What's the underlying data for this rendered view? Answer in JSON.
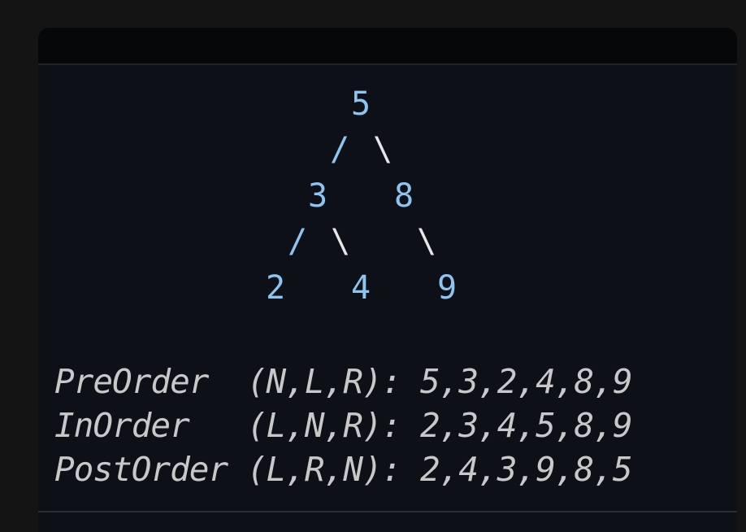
{
  "tree": {
    "nodes": {
      "root": "5",
      "left": "3",
      "right": "8",
      "left_left": "2",
      "left_right": "4",
      "right_right": "9"
    },
    "edges": {
      "root_left": "/",
      "root_right": "\\",
      "l_left": "/",
      "l_right": "\\",
      "r_right": "\\"
    }
  },
  "traversals": [
    {
      "name": "PreOrder",
      "order": "(N,L,R):",
      "result": "5,3,2,4,8,9"
    },
    {
      "name": "InOrder",
      "order": "(L,N,R):",
      "result": "2,3,4,5,8,9"
    },
    {
      "name": "PostOrder",
      "order": "(L,R,N):",
      "result": "2,4,3,9,8,5"
    }
  ],
  "colors": {
    "node": "#8cc4f2",
    "text": "#c8c8c8",
    "background": "#0d1117"
  }
}
